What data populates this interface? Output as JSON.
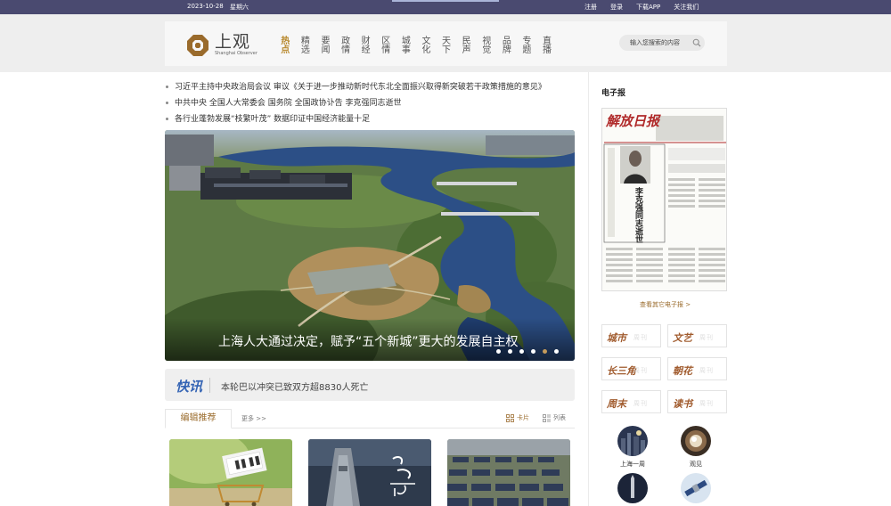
{
  "topbar": {
    "date": "2023-10-28",
    "weekday": "星期六",
    "links": [
      "注册",
      "登录",
      "下载APP",
      "关注我们"
    ]
  },
  "header": {
    "logo_name": "上观",
    "logo_sub": "Shanghai Observer",
    "nav": [
      "热点",
      "精选",
      "要闻",
      "政情",
      "财经",
      "区情",
      "城事",
      "文化",
      "天下",
      "民声",
      "视觉",
      "品牌",
      "专题",
      "直播"
    ],
    "active_nav": "热点",
    "search_placeholder": "输入您搜索的内容"
  },
  "headlines": [
    "习近平主持中央政治局会议 审议《关于进一步推动新时代东北全面振兴取得新突破若干政策措施的意见》",
    "中共中央 全国人大常委会 国务院 全国政协讣告 李克强同志逝世",
    "各行业蓬勃发展“枝繁叶茂” 数据印证中国经济能量十足"
  ],
  "hero": {
    "caption": "上海人大通过决定，赋予“五个新城”更大的发展自主权",
    "slide_count": 6,
    "active_slide": 5
  },
  "flash": {
    "logo": "快讯",
    "text": "本轮巴以冲突已致双方超8830人死亡"
  },
  "picks": {
    "tab": "编辑推荐",
    "more": "更多 >>",
    "view_card": "卡片",
    "view_list": "列表"
  },
  "right": {
    "epaper_title": "电子报",
    "epaper_masthead": "解放日报",
    "epaper_name_vertical": "李克强同志逝世",
    "epaper_more": "查看其它电子报 >",
    "papers": [
      "城市",
      "文艺",
      "长三角",
      "朝花",
      "周末",
      "读书"
    ],
    "paper_ext": "周刊",
    "circles": [
      "上海一周",
      "观见"
    ]
  },
  "colors": {
    "topbar": "#4a4a70",
    "accent_gold": "#b8892d",
    "flash_blue": "#3464b4",
    "dot_active": "#c59b5b"
  }
}
